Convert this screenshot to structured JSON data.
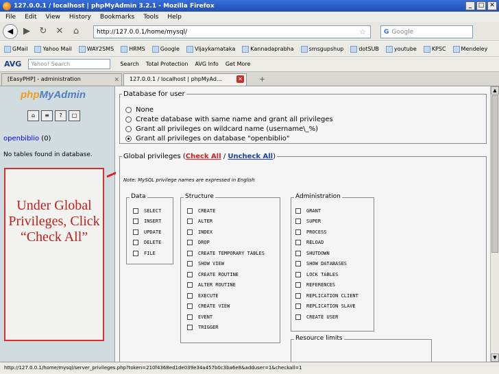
{
  "window": {
    "title": "127.0.0.1 / localhost | phpMyAdmin 3.2.1 - Mozilla Firefox"
  },
  "menu": [
    "File",
    "Edit",
    "View",
    "History",
    "Bookmarks",
    "Tools",
    "Help"
  ],
  "nav": {
    "url": "http://127.0.0.1/home/mysql/",
    "search_placeholder": "Google",
    "search_engine": "G"
  },
  "bookmarks": [
    "GMail",
    "Yahoo Mail",
    "WAY2SMS",
    "HRMS",
    "Google",
    "Vijaykarnataka",
    "Kannadaprabha",
    "smsgupshup",
    "dotSUB",
    "youtube",
    "KPSC",
    "Mendeley"
  ],
  "avgbar": {
    "logo": "AVG",
    "search_placeholder": "Yahoo! Search",
    "items": [
      "Search",
      "Total Protection",
      "AVG Info",
      "Get More"
    ]
  },
  "tabs": [
    {
      "label": "[EasyPHP] - administration"
    },
    {
      "label": "127.0.0.1 / localhost | phpMyAd..."
    }
  ],
  "left": {
    "logo_a": "php",
    "logo_b": "MyAdmin",
    "db_name": "openbiblio",
    "db_count": "(0)",
    "no_tables": "No tables found in database."
  },
  "callout": "Under Global Privileges, Click “Check All”",
  "db_user": {
    "legend": "Database for user",
    "options": [
      "None",
      "Create database with same name and grant all privileges",
      "Grant all privileges on wildcard name (username\\_%)",
      "Grant all privileges on database \"openbiblio\""
    ],
    "selected_index": 3
  },
  "global": {
    "legend_prefix": "Global privileges (",
    "check_all": "Check All",
    "sep": " / ",
    "uncheck_all": "Uncheck All",
    "legend_suffix": ")",
    "note": "Note: MySQL privilege names are expressed in English"
  },
  "data_group": {
    "title": "Data",
    "items": [
      "SELECT",
      "INSERT",
      "UPDATE",
      "DELETE",
      "FILE"
    ]
  },
  "structure_group": {
    "title": "Structure",
    "items": [
      "CREATE",
      "ALTER",
      "INDEX",
      "DROP",
      "CREATE TEMPORARY TABLES",
      "SHOW VIEW",
      "CREATE ROUTINE",
      "ALTER ROUTINE",
      "EXECUTE",
      "CREATE VIEW",
      "EVENT",
      "TRIGGER"
    ]
  },
  "admin_group": {
    "title": "Administration",
    "items": [
      "GRANT",
      "SUPER",
      "PROCESS",
      "RELOAD",
      "SHUTDOWN",
      "SHOW DATABASES",
      "LOCK TABLES",
      "REFERENCES",
      "REPLICATION CLIENT",
      "REPLICATION SLAVE",
      "CREATE USER"
    ]
  },
  "resource_limits": "Resource limits",
  "status": "http://127.0.0.1/home/mysql/server_privileges.php?token=210f4368ed1de039e34a457b0c3ba6e8&adduser=1&checkall=1",
  "colors": {
    "accent_red": "#d0201f",
    "link_blue": "#1b3ea8",
    "titlebar": "#1f4fb5"
  }
}
